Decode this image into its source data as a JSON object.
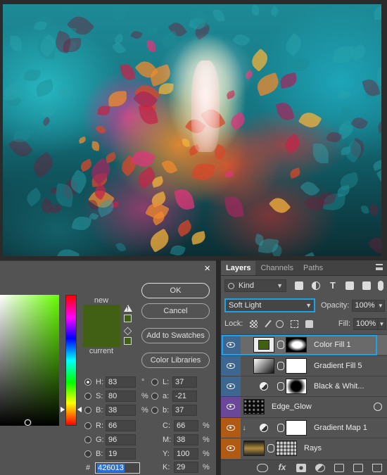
{
  "picker": {
    "close_glyph": "×",
    "new_label": "new",
    "current_label": "current",
    "new_color": "#426013",
    "current_color": "#426013",
    "buttons": {
      "ok": "OK",
      "cancel": "Cancel",
      "add_to_swatches": "Add to Swatches",
      "color_libraries": "Color Libraries"
    },
    "hsb": {
      "h": {
        "label": "H:",
        "value": "83",
        "unit": "°"
      },
      "s": {
        "label": "S:",
        "value": "80",
        "unit": "%"
      },
      "b": {
        "label": "B:",
        "value": "38",
        "unit": "%"
      }
    },
    "rgb": {
      "r": {
        "label": "R:",
        "value": "66"
      },
      "g": {
        "label": "G:",
        "value": "96"
      },
      "b": {
        "label": "B:",
        "value": "19"
      }
    },
    "lab": {
      "l": {
        "label": "L:",
        "value": "37"
      },
      "a": {
        "label": "a:",
        "value": "-21"
      },
      "b": {
        "label": "b:",
        "value": "37"
      }
    },
    "cmyk": {
      "c": {
        "label": "C:",
        "value": "66",
        "unit": "%"
      },
      "m": {
        "label": "M:",
        "value": "38",
        "unit": "%"
      },
      "y": {
        "label": "Y:",
        "value": "100",
        "unit": "%"
      },
      "k": {
        "label": "K:",
        "value": "29",
        "unit": "%"
      }
    },
    "hex": {
      "label": "#",
      "value": "426013"
    }
  },
  "layers_panel": {
    "tabs": [
      "Layers",
      "Channels",
      "Paths"
    ],
    "filter": {
      "kind_label": "Kind"
    },
    "blend_mode": "Soft Light",
    "opacity_label": "Opacity:",
    "opacity_value": "100%",
    "lock_label": "Lock:",
    "fill_label": "Fill:",
    "fill_value": "100%",
    "layers": [
      {
        "name": "Color Fill 1",
        "eye_color": "blue",
        "selected": true
      },
      {
        "name": "Gradient Fill 5",
        "eye_color": "blue",
        "selected": false
      },
      {
        "name": "Black & Whit...",
        "eye_color": "blue",
        "selected": false
      },
      {
        "name": "Edge_Glow",
        "eye_color": "purple",
        "selected": false
      },
      {
        "name": "Gradient Map 1",
        "eye_color": "orange",
        "selected": false
      },
      {
        "name": "Rays",
        "eye_color": "orange",
        "selected": false
      }
    ]
  },
  "colors": {
    "selection_accent": "#1aa3e8",
    "panel_bg": "#535353"
  },
  "icons": {
    "close": "close-icon",
    "eye": "eye-icon",
    "link": "link-chain-icon",
    "fx": "fx-icon",
    "trash": "trash-icon"
  }
}
